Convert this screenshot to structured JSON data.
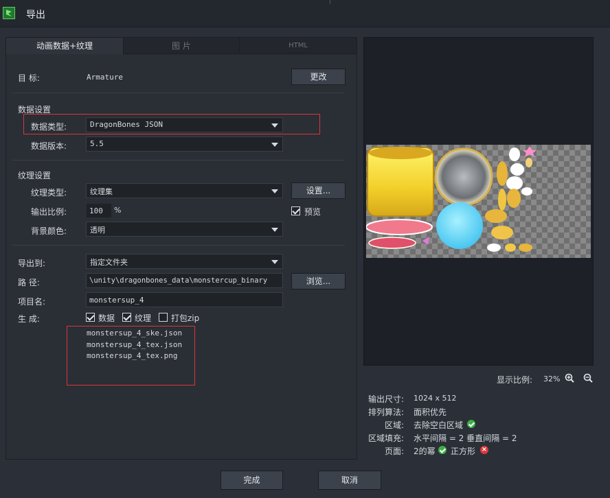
{
  "window": {
    "title": "导出"
  },
  "tabs": [
    "动画数据+纹理",
    "图 片",
    "HTML"
  ],
  "target": {
    "label": "目 标:",
    "value": "Armature",
    "button": "更改"
  },
  "data_settings": {
    "heading": "数据设置",
    "type_label": "数据类型:",
    "type_value": "DragonBones JSON",
    "version_label": "数据版本:",
    "version_value": "5.5"
  },
  "texture_settings": {
    "heading": "纹理设置",
    "type_label": "纹理类型:",
    "type_value": "纹理集",
    "settings_button": "设置...",
    "scale_label": "输出比例:",
    "scale_value": "100",
    "scale_unit": "%",
    "preview_label": "预览",
    "preview_checked": true,
    "bg_label": "背景颜色:",
    "bg_value": "透明"
  },
  "export": {
    "to_label": "导出到:",
    "to_value": "指定文件夹",
    "path_label": "路 径:",
    "path_value": "\\unity\\dragonbones_data\\monstercup_binary",
    "browse_button": "浏览...",
    "name_label": "项目名:",
    "name_value": "monstersup_4",
    "generate_label": "生 成:",
    "gen_data": "数据",
    "gen_texture": "纹理",
    "gen_zip": "打包zip",
    "files": [
      "monstersup_4_ske.json",
      "monstersup_4_tex.json",
      "monstersup_4_tex.png"
    ]
  },
  "preview": {
    "zoom_label": "显示比例:",
    "zoom_value": "32%",
    "icons": [
      "zoom-in-icon",
      "zoom-out-icon"
    ]
  },
  "info": {
    "size_label": "输出尺寸:",
    "size_value": "1024 x 512",
    "algo_label": "排列算法:",
    "algo_value": "面积优先",
    "region_label": "区域:",
    "region_value": "去除空白区域",
    "fill_label": "区域填充:",
    "fill_value": "水平间隔 = 2 垂直间隔 = 2",
    "page_label": "页面:",
    "page_value": "2的幂",
    "square_value": "正方形"
  },
  "footer": {
    "ok": "完成",
    "cancel": "取消"
  },
  "colors": {
    "background": "#2b3038",
    "panel": "#2a2e35",
    "highlight_box": "#d8383a",
    "ok_green": "#3cb043",
    "error_red": "#d93a3a"
  }
}
